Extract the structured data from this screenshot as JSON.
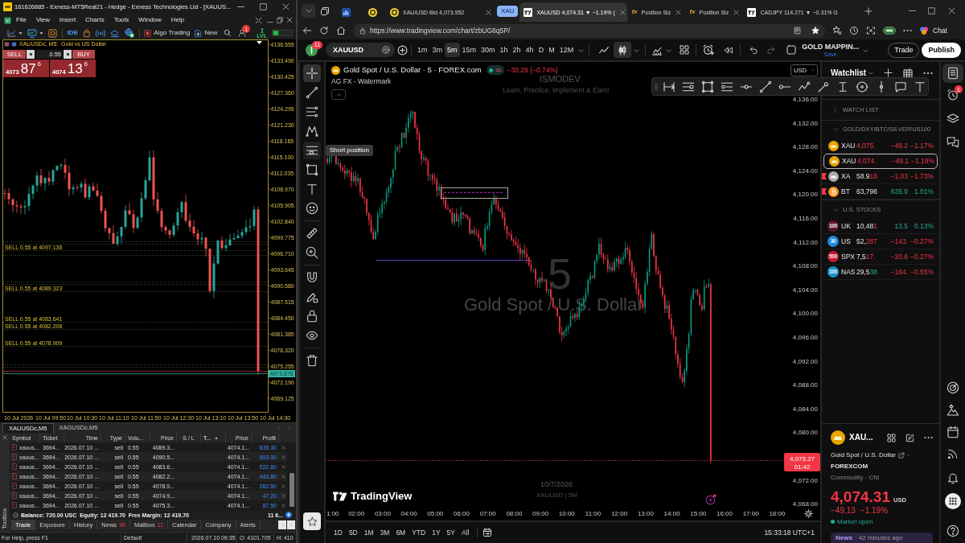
{
  "mt5": {
    "title": "161626885 - Exness-MT5Real21 - Hedge - Exness Technologies Ltd - [XAUUS...",
    "menu": [
      "File",
      "View",
      "Insert",
      "Charts",
      "Tools",
      "Window",
      "Help"
    ],
    "toolbar": {
      "ide": "IDE",
      "algo_trading": "Algo Trading",
      "new_order": "New",
      "alert_count": "1",
      "level_label": "LVL"
    },
    "chart": {
      "symbol_label": "XAUUSDc, M5:  Gold vs US Dollar",
      "sell": "SELL",
      "buy": "BUY",
      "volume": "0.55",
      "bid": {
        "head": "4073",
        "main": "87",
        "tail": "6"
      },
      "ask": {
        "head": "4074",
        "main": "13",
        "tail": "6"
      },
      "price_ticks": [
        "4136.555",
        "4133.490",
        "4130.425",
        "4127.360",
        "4124.295",
        "4121.230",
        "4118.165",
        "4115.100",
        "4112.035",
        "4108.970",
        "4105.905",
        "4102.840",
        "4099.775",
        "4096.710",
        "4093.645",
        "4090.580",
        "4087.515",
        "4084.450",
        "4081.385",
        "4078.320",
        "4075.255",
        "4072.190",
        "4069.125"
      ],
      "current_price": "4073.876",
      "time_ticks": [
        "10 Jul 2026",
        "10 Jul 09:50",
        "10 Jul 10:30",
        "10 Jul 11:10",
        "10 Jul 11:50",
        "10 Jul 12:30",
        "10 Jul 13:10",
        "10 Jul 13:50",
        "10 Jul 14:30"
      ],
      "order_labels": [
        "SELL 0.55 at 4097.136",
        "SELL 0.55 at 4089.323",
        "SELL 0.55 at 4083.641",
        "SELL 0.55 at 4082.206",
        "SELL 0.55 at 4078.909"
      ]
    },
    "chart_tabs": [
      {
        "label": "XAUUSDc,M5",
        "selected": true
      },
      {
        "label": "XAGUSDc,M5",
        "selected": false
      }
    ],
    "toolbox": {
      "side_label": "Toolbox",
      "columns": [
        {
          "label": "Symbol",
          "sorted": false
        },
        {
          "label": "Ticket",
          "sorted": false
        },
        {
          "label": "Time",
          "sorted": false
        },
        {
          "label": "Type",
          "sorted": false
        },
        {
          "label": "Volu...",
          "sorted": false
        },
        {
          "label": "Price",
          "sorted": false
        },
        {
          "label": "S / L",
          "sorted": false
        },
        {
          "label": "T...",
          "sorted": true
        },
        {
          "label": "Price",
          "sorted": false
        },
        {
          "label": "Profit",
          "sorted": false
        }
      ],
      "rows": [
        {
          "symbol": "xauus...",
          "ticket": "3694...",
          "time": "2026.07.10 ...",
          "type": "sell",
          "volume": "0.55",
          "price": "4089.3...",
          "current_price": "4074.1...",
          "profit": "835.30"
        },
        {
          "symbol": "xauus...",
          "ticket": "3694...",
          "time": "2026.07.10 ...",
          "type": "sell",
          "volume": "0.55",
          "price": "4090.5...",
          "current_price": "4074.1...",
          "profit": "903.00"
        },
        {
          "symbol": "xauus...",
          "ticket": "3694...",
          "time": "2026.07.10 ...",
          "type": "sell",
          "volume": "0.55",
          "price": "4083.6...",
          "current_price": "4074.1...",
          "profit": "522.80"
        },
        {
          "symbol": "xauus...",
          "ticket": "3694...",
          "time": "2026.07.10 ...",
          "type": "sell",
          "volume": "0.55",
          "price": "4082.2...",
          "current_price": "4074.1...",
          "profit": "443.80"
        },
        {
          "symbol": "xauus...",
          "ticket": "3694...",
          "time": "2026.07.10 ...",
          "type": "sell",
          "volume": "0.55",
          "price": "4078.9...",
          "current_price": "4074.1...",
          "profit": "262.50"
        },
        {
          "symbol": "xauus...",
          "ticket": "3694...",
          "time": "2026.07.10 ...",
          "type": "sell",
          "volume": "0.55",
          "price": "4074.9...",
          "current_price": "4074.1...",
          "profit": "47.20"
        },
        {
          "symbol": "xauus...",
          "ticket": "3694...",
          "time": "2026.07.10 ...",
          "type": "sell",
          "volume": "0.55",
          "price": "4075.3...",
          "current_price": "4074.1...",
          "profit": "67.50"
        }
      ],
      "summary": "Balance: 720.00 USC  Equity: 12 419.70  Free Margin: 12 419.70",
      "summary_total": "11 6...",
      "tabs": [
        {
          "label": "Trade",
          "selected": true
        },
        {
          "label": "Exposure",
          "selected": false
        },
        {
          "label": "History",
          "selected": false
        },
        {
          "label": "News",
          "count": "99",
          "selected": false
        },
        {
          "label": "Mailbox",
          "count": "11",
          "selected": false
        },
        {
          "label": "Calendar",
          "selected": false
        },
        {
          "label": "Company",
          "selected": false
        },
        {
          "label": "Alerts",
          "selected": false
        }
      ]
    },
    "status_bar": [
      "For Help, press F1",
      "Default",
      "2026.07.10 09:35",
      "O: 4101.705",
      "H: 410"
    ]
  },
  "browser": {
    "tabs": [
      {
        "kind": "icon",
        "selected": false
      },
      {
        "kind": "icon",
        "selected": false
      },
      {
        "kind": "page",
        "title": "XAU/USD Bid 4,073.952",
        "closable": true,
        "selected": false
      },
      {
        "kind": "group",
        "title": "XAU",
        "selected": false
      },
      {
        "kind": "page",
        "title": "XAUUSD 4,074.31 ▼ −1.19% (",
        "closable": true,
        "selected": true
      },
      {
        "kind": "page",
        "favicon_text": "fx",
        "title": "Position Siz",
        "closable": true,
        "selected": false
      },
      {
        "kind": "page",
        "favicon_text": "fx",
        "title": "Position Siz",
        "closable": true,
        "selected": false
      },
      {
        "kind": "page",
        "title": "CADJPY 114.271 ▼ −0.31% G",
        "closable": false,
        "selected": false
      }
    ],
    "url": "https://www.tradingview.com/chart/zbUG6q5P/",
    "chat": "Chat"
  },
  "tradingview": {
    "header": {
      "avatar_badge": "11",
      "symbol": "XAUUSD",
      "intervals": [
        {
          "label": "1m",
          "selected": false
        },
        {
          "label": "3m",
          "selected": false
        },
        {
          "label": "5m",
          "selected": true
        },
        {
          "label": "15m",
          "selected": false
        },
        {
          "label": "30m",
          "selected": false
        },
        {
          "label": "1h",
          "selected": false
        },
        {
          "label": "2h",
          "selected": false
        },
        {
          "label": "4h",
          "selected": false
        },
        {
          "label": "D",
          "selected": false
        },
        {
          "label": "M",
          "selected": false
        },
        {
          "label": "12M",
          "selected": false
        }
      ],
      "chart_types": [
        {
          "selected": false
        },
        {
          "selected": true
        }
      ],
      "layout_name": "GOLD MAPPIN...",
      "layout_status": "Save",
      "trade": "Trade",
      "publish": "Publish"
    },
    "drawing_tools": [
      {
        "selected": true,
        "hovered": false
      },
      {
        "selected": false,
        "hovered": false
      },
      {
        "selected": false,
        "hovered": false
      },
      {
        "selected": false,
        "hovered": false
      },
      {
        "selected": false,
        "hovered": true
      },
      {
        "selected": false,
        "hovered": false
      },
      {
        "selected": false,
        "hovered": false
      },
      {
        "selected": false,
        "hovered": false
      },
      {
        "selected": false,
        "hovered": false
      },
      {
        "selected": false,
        "hovered": false
      },
      {
        "selected": false,
        "hovered": false
      },
      {
        "selected": false,
        "hovered": false
      },
      {
        "selected": false,
        "hovered": false
      },
      {
        "selected": false,
        "hovered": false
      },
      {
        "selected": false,
        "hovered": false
      }
    ],
    "tooltip": "Short position",
    "legend": {
      "title": "Gold Spot / U.S. Dollar · 5 · FOREX.com",
      "change": "−30.26 (−0.74%)",
      "indicator": "AG FX - Watermark"
    },
    "currency": "USD",
    "watermark": {
      "title": "ISMODEV",
      "tagline": "Learn, Practice, Implement & Earn!",
      "interval": "5",
      "symbol_name": "Gold Spot / U.S. Dollar",
      "date": "10/7/2026",
      "caption": "XAUUSD | 5M"
    },
    "price_ticks": [
      "4,136.00",
      "4,132.00",
      "4,128.00",
      "4,124.00",
      "4,120.00",
      "4,116.00",
      "4,112.00",
      "4,108.00",
      "4,104.00",
      "4,100.00",
      "4,096.00",
      "4,092.00",
      "4,088.00",
      "4,084.00",
      "4,080.00",
      "4,072.00",
      "4,068.00"
    ],
    "price_tag": "4,075.27",
    "countdown": "01:42",
    "time_ticks": [
      "1:00",
      "02:00",
      "03:00",
      "04:00",
      "05:00",
      "06:00",
      "07:00",
      "08:00",
      "09:00",
      "10:00",
      "11:00",
      "12:00",
      "13:00",
      "14:00",
      "15:00",
      "16:00",
      "17:00",
      "18:00"
    ],
    "brand": "TradingView",
    "ranges": [
      "1D",
      "5D",
      "1M",
      "3M",
      "6M",
      "YTD",
      "1Y",
      "5Y",
      "All"
    ],
    "clock": "15:33:18 UTC+1",
    "watchlist": {
      "title": "Watchlist",
      "sections": [
        {
          "title": "WATCH LIST",
          "expanded": false
        },
        {
          "title": "GOLD/DXY/BTC/SILVER/US100",
          "expanded": true,
          "items": [
            {
              "kind": "gold",
              "symbol": "XAU",
              "price_tail": "4,075.",
              "tick_falling": true,
              "change": "−48.2",
              "change_pct": "−1.17%",
              "falling": true,
              "flagged": false,
              "selected": false
            },
            {
              "kind": "gold",
              "symbol": "XAU",
              "price_tail": "4,074.",
              "tick_falling": true,
              "change": "−49.1",
              "change_pct": "−1.19%",
              "falling": true,
              "flagged": false,
              "selected": true
            },
            {
              "kind": "silver",
              "symbol": "XA",
              "price_head": "58.9",
              "price_tail": "18",
              "tick_falling": true,
              "change": "−1.03",
              "change_pct": "−1.73%",
              "falling": true,
              "flagged": true,
              "selected": false
            },
            {
              "kind": "bitcoin",
              "symbol": "BT",
              "price_head": "63,796",
              "change": "635.9",
              "change_pct": "1.01%",
              "falling": false,
              "flagged": true,
              "selected": false
            }
          ]
        },
        {
          "title": "U.S. STOCKS",
          "expanded": true,
          "items": [
            {
              "kind": "index",
              "badge": "100",
              "color": "#5c1a2b",
              "symbol": "UK",
              "price_head": "10,48",
              "price_tail": "1",
              "tick_falling": true,
              "change": "13.5",
              "change_pct": "0.13%",
              "falling": false,
              "flagged": false,
              "selected": false
            },
            {
              "kind": "index",
              "badge": "30",
              "color": "#1e88d8",
              "symbol": "US",
              "price_head": "52,",
              "price_tail": "287",
              "tick_falling": true,
              "change": "−143.",
              "change_pct": "−0.27%",
              "falling": true,
              "flagged": false,
              "selected": false
            },
            {
              "kind": "index",
              "badge": "500",
              "color": "#c0182e",
              "symbol": "SPX",
              "price_head": "7,5",
              "price_tail": "17.",
              "tick_falling": true,
              "change": "−20.6",
              "change_pct": "−0.27%",
              "falling": true,
              "flagged": false,
              "selected": false
            },
            {
              "kind": "index",
              "badge": "100",
              "color": "#1a8fc9",
              "symbol": "NAS",
              "price_head": "29,5",
              "price_tail": "38",
              "tick_falling": false,
              "change": "−164.",
              "change_pct": "−0.55%",
              "falling": true,
              "flagged": false,
              "selected": false
            }
          ]
        }
      ]
    },
    "details": {
      "symbol": "XAU...",
      "name": "Gold Spot / U.S. Dollar",
      "separator": "·",
      "exchange": "FOREXCOM",
      "category": "Commodity · Cfd",
      "price": "4,074.31",
      "currency": "USD",
      "change": "−49.13",
      "change_pct": "−1.19%",
      "market_status": "Market open",
      "news_label": "News",
      "news_time": "· 42 minutes ago"
    },
    "sidebar_buttons": [
      {
        "selected": true
      },
      {
        "selected": false,
        "badge": "1"
      },
      {
        "selected": false
      },
      {
        "selected": false
      },
      {
        "selected": false
      },
      {
        "selected": false
      },
      {
        "selected": false
      },
      {
        "selected": false
      },
      {
        "selected": false
      },
      {
        "selected": false
      },
      {
        "selected": false
      }
    ]
  }
}
